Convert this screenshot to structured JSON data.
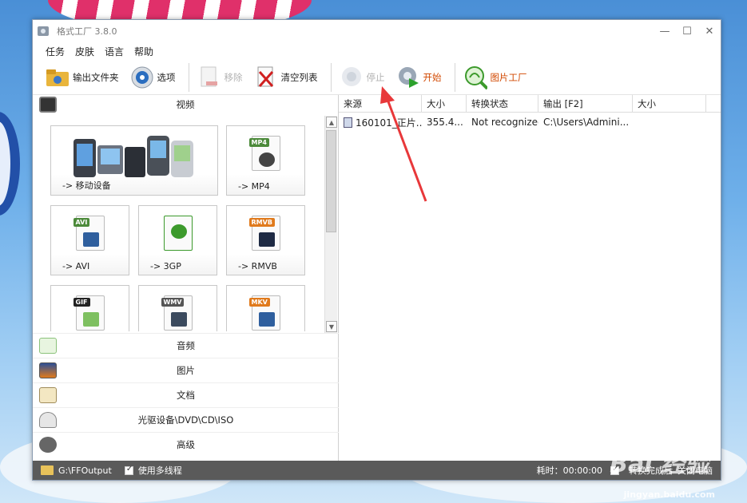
{
  "window": {
    "title": "格式工厂 3.8.0",
    "controls": [
      "—",
      "☐",
      "✕"
    ]
  },
  "menu": [
    "任务",
    "皮肤",
    "语言",
    "帮助"
  ],
  "toolbar": {
    "output_folder": "输出文件夹",
    "options": "选项",
    "remove": "移除",
    "clear_list": "清空列表",
    "stop": "停止",
    "start": "开始",
    "picture_factory": "图片工厂"
  },
  "left": {
    "video_category": "视频",
    "tiles": [
      "-> 移动设备",
      "-> MP4",
      "-> AVI",
      "-> 3GP",
      "-> RMVB"
    ],
    "format_tags": [
      "MP4",
      "AVI",
      "RMVB",
      "GIF",
      "WMV",
      "MKV"
    ],
    "categories": [
      "音频",
      "图片",
      "文档",
      "光驱设备\\DVD\\CD\\ISO",
      "高级"
    ]
  },
  "table": {
    "headers": [
      "来源",
      "大小",
      "转换状态",
      "输出 [F2]",
      "大小"
    ],
    "rows": [
      [
        "160101_正片...",
        "355.4...",
        "Not recognized",
        "C:\\Users\\Admini...",
        ""
      ]
    ]
  },
  "statusbar": {
    "output_path": "G:\\FFOutput",
    "multithread": "使用多线程",
    "elapsed": "耗时：00:00:00",
    "after_convert": "转换完成后",
    "shutdown": "关闭电脑"
  },
  "watermark": {
    "brand": "Bai 经验",
    "url": "jingyan.baidu.com"
  },
  "colors": {
    "accent": "#d24800",
    "statusbar": "#5a5a5a",
    "arrow": "#e8383a"
  }
}
